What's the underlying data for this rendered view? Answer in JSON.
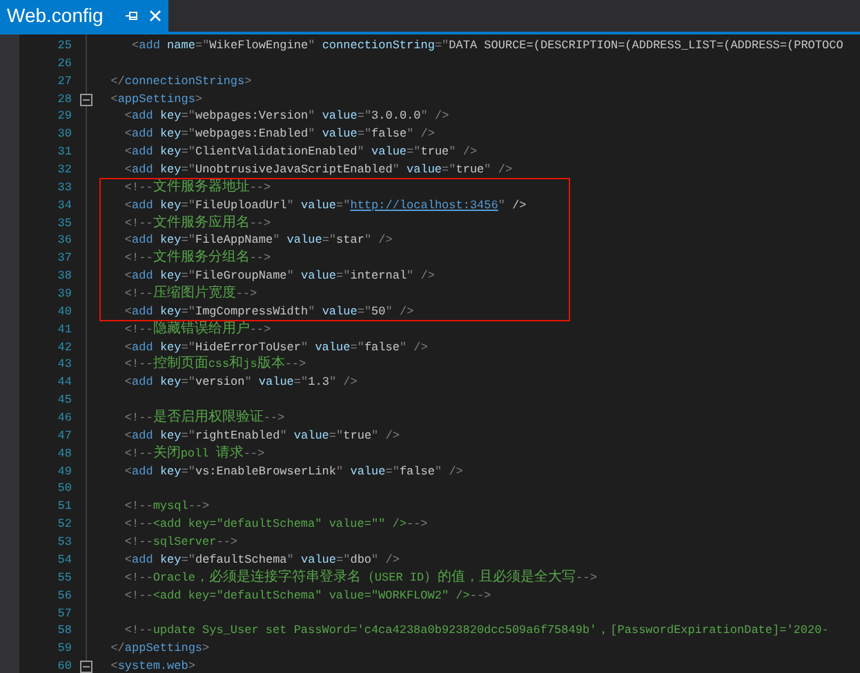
{
  "tabs": [
    {
      "title": "Web.config",
      "selected": true
    }
  ],
  "sections": [
    {
      "boxed": false,
      "lines": [
        {
          "number": "25",
          "kind": "element",
          "text": "     <add name=\"WikeFlowEngine\" connectionString=\"DATA SOURCE=(DESCRIPTION=(ADDRESS_LIST=(ADDRESS=(PROTOCO"
        },
        {
          "number": "26",
          "kind": "element"
        },
        {
          "number": "27",
          "kind": "element",
          "text": "  </connectionStrings>"
        },
        {
          "number": "28",
          "kind": "element",
          "text": "  <appSettings>",
          "expanded": true
        },
        {
          "number": "29",
          "kind": "element",
          "text": "    <add key=\"webpages:Version\" value=\"3.0.0.0\" />"
        },
        {
          "number": "30",
          "kind": "element",
          "text": "    <add key=\"webpages:Enabled\" value=\"false\" />"
        },
        {
          "number": "31",
          "kind": "element",
          "text": "    <add key=\"ClientValidationEnabled\" value=\"true\" />"
        },
        {
          "number": "32",
          "kind": "element",
          "text": "    <add key=\"UnobtrusiveJavaScriptEnabled\" value=\"true\" />"
        }
      ]
    },
    {
      "boxed": true,
      "lines": [
        {
          "number": "33",
          "kind": "comment",
          "text": "    <!--文件服务器地址-->"
        },
        {
          "number": "34",
          "kind": "element",
          "text": "    <add key=\"FileUploadUrl\" value=\"",
          "link": "http://localhost:3456",
          "after": "\" />"
        },
        {
          "number": "35",
          "kind": "comment",
          "text": "    <!--文件服务应用名-->"
        },
        {
          "number": "36",
          "kind": "element",
          "text": "    <add key=\"FileAppName\" value=\"star\" />"
        },
        {
          "number": "37",
          "kind": "comment",
          "text": "    <!--文件服务分组名-->"
        },
        {
          "number": "38",
          "kind": "element",
          "text": "    <add key=\"FileGroupName\" value=\"internal\" />"
        },
        {
          "number": "39",
          "kind": "comment",
          "text": "    <!--压缩图片宽度-->"
        },
        {
          "number": "40",
          "kind": "element",
          "text": "    <add key=\"ImgCompressWidth\" value=\"50\" />"
        }
      ]
    },
    {
      "boxed": false,
      "lines": [
        {
          "number": "41",
          "kind": "comment",
          "text": "    <!--隐藏错误给用户-->"
        },
        {
          "number": "42",
          "kind": "element",
          "text": "    <add key=\"HideErrorToUser\" value=\"false\" />"
        },
        {
          "number": "43",
          "kind": "comment",
          "text": "    <!--控制页面css和js版本-->"
        },
        {
          "number": "44",
          "kind": "element",
          "text": "    <add key=\"version\" value=\"1.3\" />"
        },
        {
          "number": "45",
          "kind": "element"
        },
        {
          "number": "46",
          "kind": "comment",
          "text": "    <!--是否启用权限验证-->"
        },
        {
          "number": "47",
          "kind": "element",
          "text": "    <add key=\"rightEnabled\" value=\"true\" />"
        },
        {
          "number": "48",
          "kind": "comment",
          "text": "    <!--关闭poll 请求-->"
        },
        {
          "number": "49",
          "kind": "element",
          "text": "    <add key=\"vs:EnableBrowserLink\" value=\"false\" />"
        },
        {
          "number": "50",
          "kind": "element"
        },
        {
          "number": "51",
          "kind": "comment",
          "text": "    <!--mysql-->"
        },
        {
          "number": "52",
          "kind": "comment",
          "text": "    <!--<add key=\"defaultSchema\" value=\"\" />-->"
        },
        {
          "number": "53",
          "kind": "comment",
          "text": "    <!--sqlServer-->"
        },
        {
          "number": "54",
          "kind": "element",
          "text": "    <add key=\"defaultSchema\" value=\"dbo\" />"
        },
        {
          "number": "55",
          "kind": "comment",
          "text": "    <!--Oracle，必须是连接字符串登录名（USER ID）的值，且必须是全大写-->"
        },
        {
          "number": "56",
          "kind": "comment",
          "text": "    <!--<add key=\"defaultSchema\" value=\"WORKFLOW2\" />-->"
        },
        {
          "number": "57",
          "kind": "element"
        },
        {
          "number": "58",
          "kind": "comment",
          "text": "    <!--update Sys_User set PassWord='c4ca4238a0b923820dcc509a6f75849b'，[PasswordExpirationDate]='2020-"
        },
        {
          "number": "59",
          "kind": "element",
          "text": "  </appSettings>"
        },
        {
          "number": "60",
          "kind": "element",
          "text": "  <system.web>",
          "expanded": true
        }
      ]
    }
  ]
}
